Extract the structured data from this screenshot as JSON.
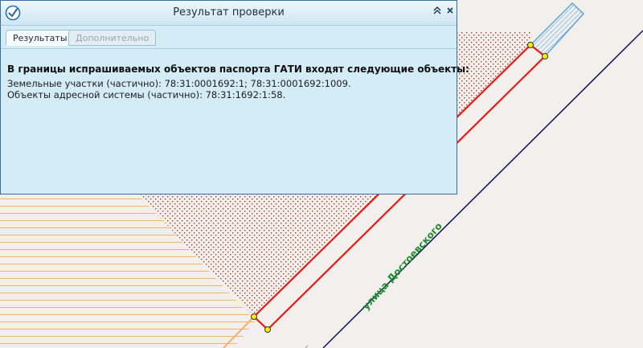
{
  "dialog": {
    "title": "Результат проверки",
    "collapse_icon": "double-chevron-up-icon",
    "close_icon": "close-icon",
    "tabs": [
      {
        "label": "Результаты",
        "active": true
      },
      {
        "label": "Дополнительно",
        "active": false
      }
    ],
    "heading": "В границы испрашиваемых объектов паспорта ГАТИ входят следующие объекты:",
    "lines": [
      "Земельные участки (частично): 78:31:0001692:1; 78:31:0001692:1009.",
      "Объекты адресной системы (частично): 78:31:1692:1:58."
    ]
  },
  "map": {
    "street_label": "улица Достоевского",
    "colors": {
      "background": "#f2efec",
      "hatch_orange": "#f0b46a",
      "dots_red": "#a33a1e",
      "selection_red": "#e41b16",
      "road_navy": "#0b1459",
      "building_blue": "#5aa5d8",
      "street_green": "#1d8f2d",
      "vertex_yellow": "#ffee00"
    }
  }
}
